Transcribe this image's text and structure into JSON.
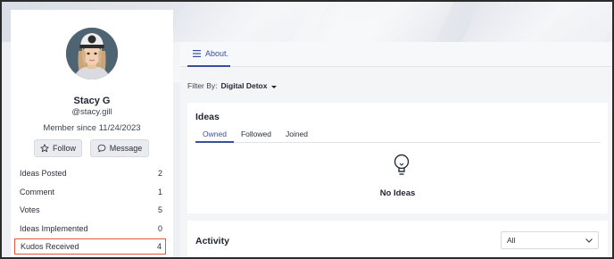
{
  "profile": {
    "name": "Stacy G",
    "handle": "@stacy.gill",
    "member_since": "Member since 11/24/2023",
    "follow_label": "Follow",
    "message_label": "Message",
    "avatar_cap_letter": "$"
  },
  "stats": [
    {
      "label": "Ideas Posted",
      "value": "2"
    },
    {
      "label": "Comment",
      "value": "1"
    },
    {
      "label": "Votes",
      "value": "5"
    },
    {
      "label": "Ideas Implemented",
      "value": "0"
    },
    {
      "label": "Kudos Received",
      "value": "4"
    }
  ],
  "main": {
    "about_tab": "About.",
    "filter_label": "Filter By:",
    "filter_value": "Digital Detox",
    "ideas": {
      "title": "Ideas",
      "tabs": [
        "Owned",
        "Followed",
        "Joined"
      ],
      "active_tab": "Owned",
      "empty_text": "No Ideas"
    },
    "activity": {
      "title": "Activity",
      "select_value": "All"
    }
  },
  "colors": {
    "accent": "#3a4f9b",
    "highlight_border": "#e0573a"
  }
}
